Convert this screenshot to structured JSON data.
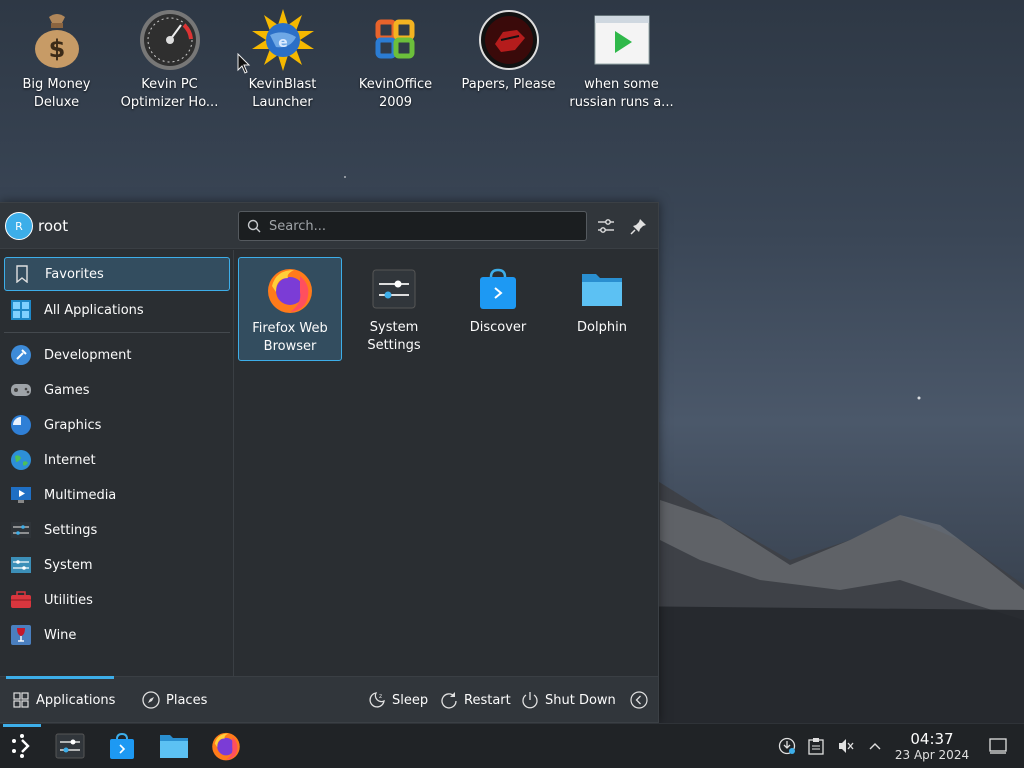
{
  "desktop": {
    "icons": [
      {
        "label": "Big Money\nDeluxe",
        "icon": "money-bag-icon"
      },
      {
        "label": "Kevin PC\nOptimizer Ho...",
        "icon": "speedometer-icon"
      },
      {
        "label": "KevinBlast\nLauncher",
        "icon": "globe-sun-icon"
      },
      {
        "label": "KevinOffice\n2009",
        "icon": "office-logo-icon"
      },
      {
        "label": "Papers, Please",
        "icon": "papers-please-icon"
      },
      {
        "label": "when some\nrussian runs a...",
        "icon": "video-player-icon"
      }
    ]
  },
  "launcher": {
    "user": {
      "initial": "R",
      "name": "root"
    },
    "search": {
      "placeholder": "Search..."
    },
    "categories": [
      {
        "label": "Favorites",
        "icon": "bookmark-icon",
        "active": true
      },
      {
        "label": "All Applications",
        "icon": "grid-icon"
      },
      {
        "label": "Development",
        "icon": "hammer-icon"
      },
      {
        "label": "Games",
        "icon": "gamepad-icon"
      },
      {
        "label": "Graphics",
        "icon": "paint-icon"
      },
      {
        "label": "Internet",
        "icon": "globe-icon"
      },
      {
        "label": "Multimedia",
        "icon": "monitor-icon"
      },
      {
        "label": "Settings",
        "icon": "sliders-icon"
      },
      {
        "label": "System",
        "icon": "system-icon"
      },
      {
        "label": "Utilities",
        "icon": "toolbox-icon"
      },
      {
        "label": "Wine",
        "icon": "wine-icon"
      }
    ],
    "favorites": [
      {
        "label": "Firefox Web Browser",
        "icon": "firefox-icon",
        "active": true
      },
      {
        "label": "System Settings",
        "icon": "system-settings-icon"
      },
      {
        "label": "Discover",
        "icon": "discover-icon"
      },
      {
        "label": "Dolphin",
        "icon": "folder-icon"
      }
    ],
    "footer": {
      "applications": "Applications",
      "places": "Places",
      "sleep": "Sleep",
      "restart": "Restart",
      "shutdown": "Shut Down"
    }
  },
  "taskbar": {
    "time": "04:37",
    "date": "23 Apr 2024"
  },
  "colors": {
    "accent": "#3daee9",
    "panel": "#2a2e32",
    "taskbar": "#202326"
  }
}
